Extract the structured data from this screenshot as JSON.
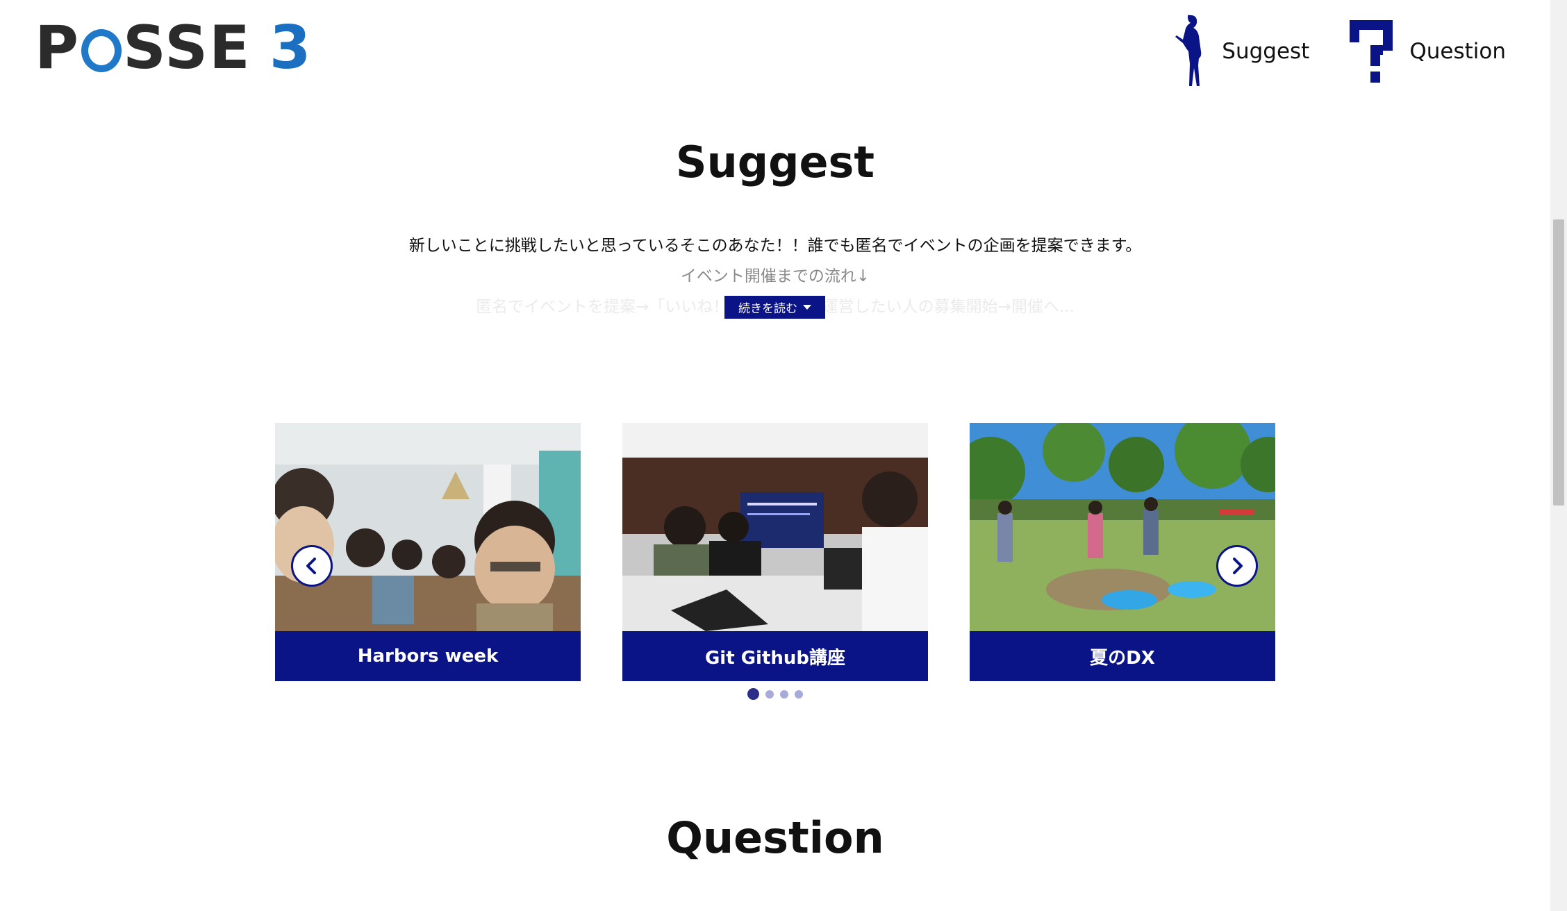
{
  "header": {
    "logo_text": "POSSE 3",
    "nav": [
      {
        "label": "Suggest",
        "icon": "silhouette-icon"
      },
      {
        "label": "Question",
        "icon": "question-mark-icon"
      }
    ]
  },
  "suggest": {
    "title": "Suggest",
    "description_line1": "新しいことに挑戦したいと思っているそこのあなた！！誰でも匿名でイベントの企画を提案できます。",
    "description_line2": "イベント開催までの流れ↓",
    "description_line3": "匿名でイベントを提案→「いいね！」が集まる→運営したい人の募集開始→開催へ...",
    "read_more_label": "続きを読む",
    "cards": [
      {
        "caption": "Harbors week",
        "image": "group-dinner-photo"
      },
      {
        "caption": "Git Github講座",
        "image": "classroom-laptops-photo"
      },
      {
        "caption": "夏のDX",
        "image": "water-gun-park-photo"
      }
    ],
    "pagination": {
      "total": 4,
      "active": 0
    }
  },
  "question": {
    "title": "Question"
  },
  "colors": {
    "brand_navy": "#0b1487",
    "logo_blue": "#1b6fc0",
    "dot_active": "#2c2f8a",
    "dot_inactive": "#a7abd9"
  }
}
